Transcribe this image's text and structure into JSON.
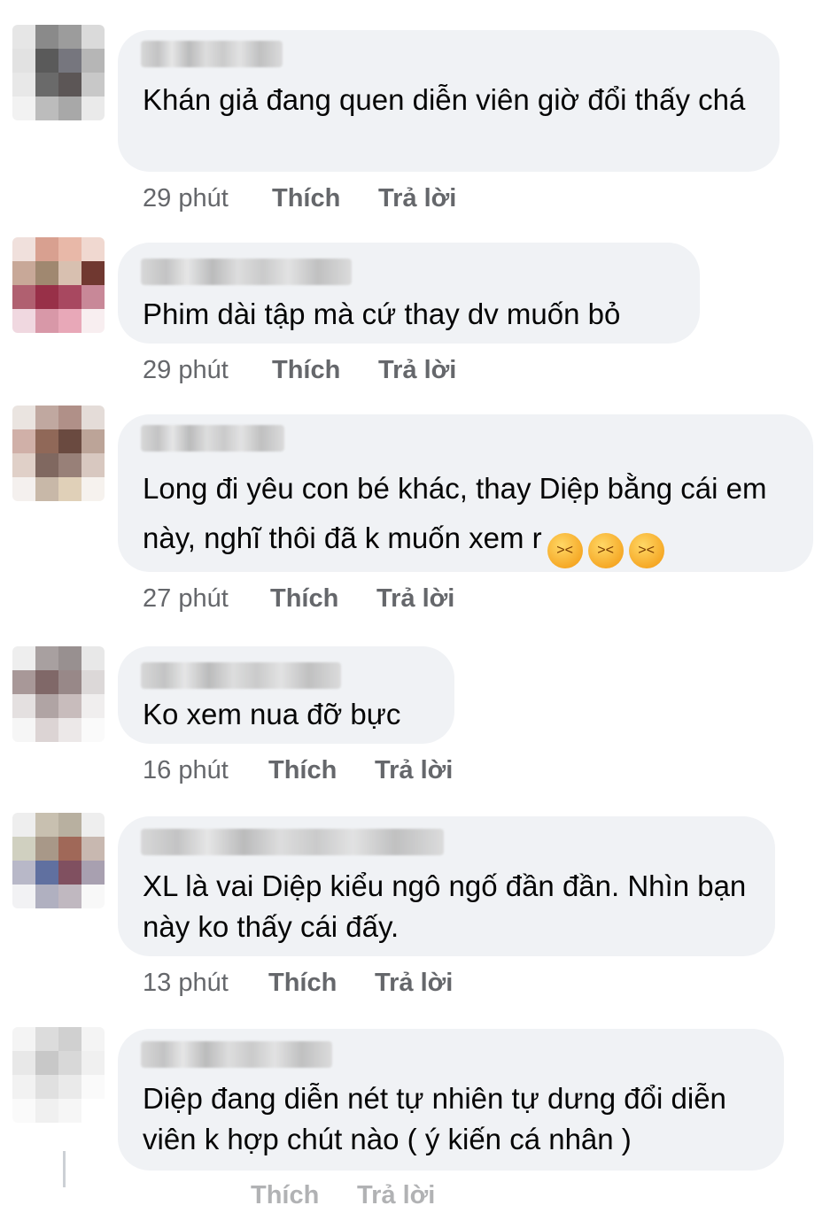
{
  "comments": [
    {
      "text": "Khán giả đang quen diễn viên giờ đổi thấy chá",
      "time": "29 phút",
      "like": "Thích",
      "reply": "Trả lời"
    },
    {
      "text": "Phim dài tập mà cứ thay dv muốn bỏ",
      "time": "29 phút",
      "like": "Thích",
      "reply": "Trả lời"
    },
    {
      "text": "Long đi yêu con bé khác, thay Diệp bằng cái em này, nghĩ thôi đã k muốn xem r",
      "emoji": "😖😖😖",
      "time": "27 phút",
      "like": "Thích",
      "reply": "Trả lời"
    },
    {
      "text": "Ko xem  nua đỡ bực",
      "time": "16 phút",
      "like": "Thích",
      "reply": "Trả lời"
    },
    {
      "text": "XL là vai Diệp kiểu ngô ngố đần đần. Nhìn bạn này ko thấy cái đấy.",
      "time": "13 phút",
      "like": "Thích",
      "reply": "Trả lời"
    },
    {
      "text": "Diệp đang diễn nét tự nhiên tự dưng đổi diễn viên k hợp chút nào ( ý kiến cá nhân )",
      "time": "",
      "like": "Thích",
      "reply": "Trả lời"
    }
  ],
  "emoji_name": "confounded-face-emoji",
  "colors": {
    "bubble": "#f0f2f5",
    "meta_text": "#65676b",
    "body_text": "#050505"
  }
}
